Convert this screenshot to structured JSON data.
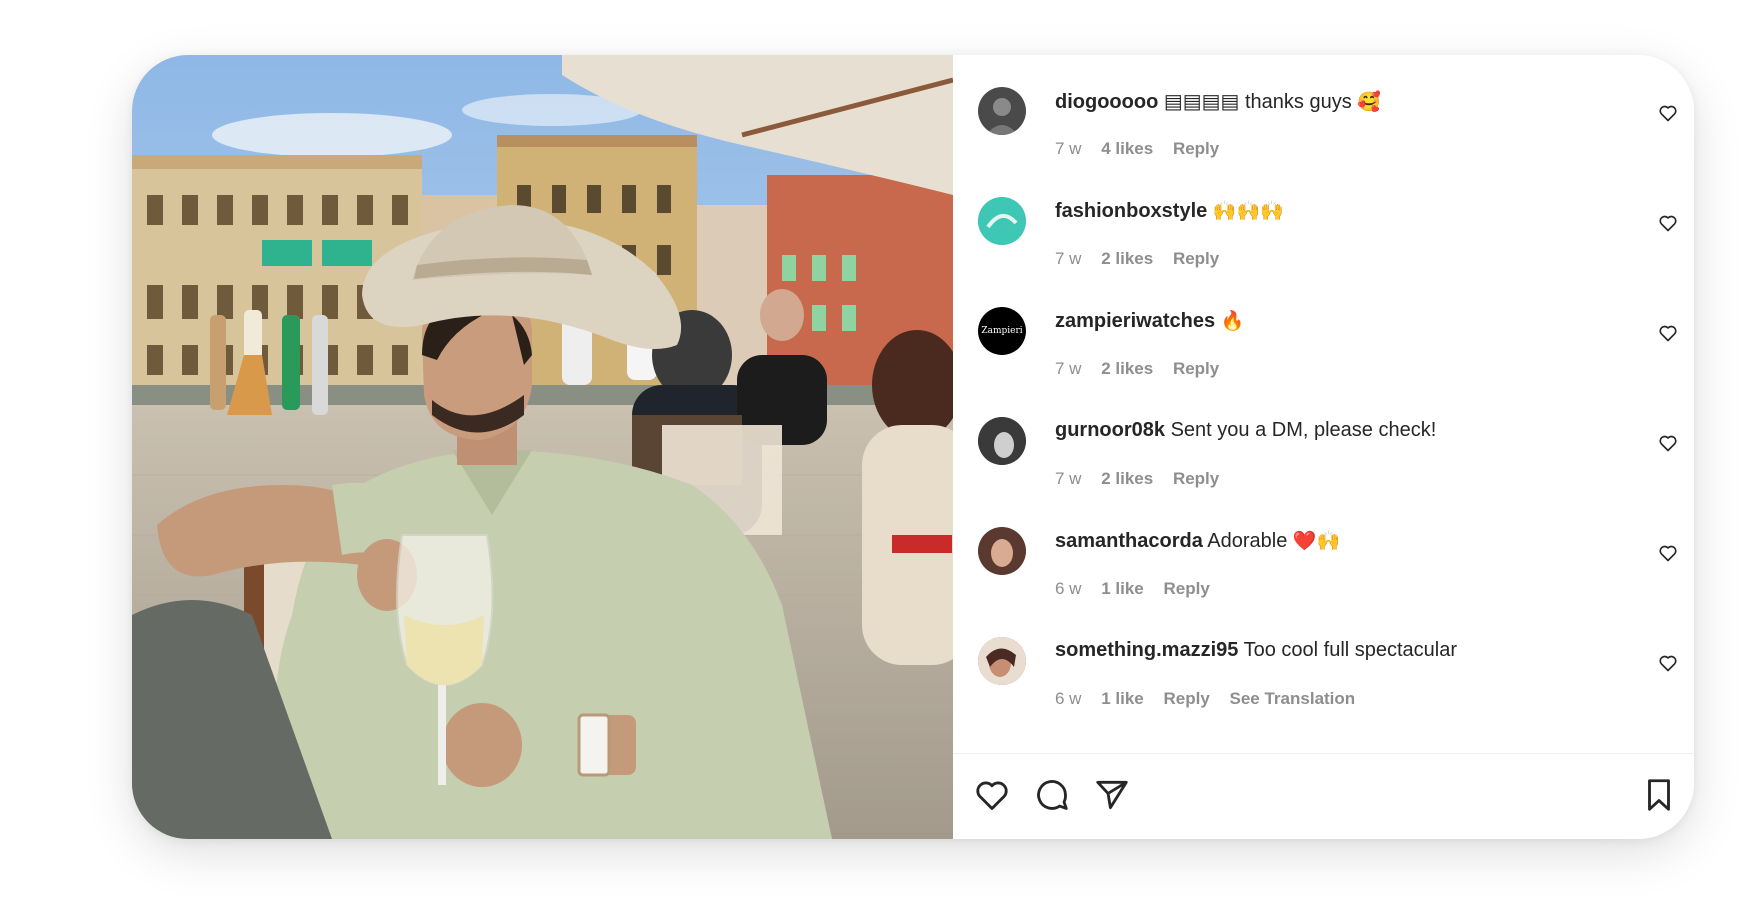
{
  "comments": [
    {
      "user": "diogooooo",
      "text": " ▤▤▤▤ thanks guys ",
      "emoji": "🥰",
      "time": "7 w",
      "likes": "4 likes",
      "reply": "Reply",
      "avatar_color": "#4a4a4a"
    },
    {
      "user": "fashionboxstyle",
      "text": " ",
      "emoji": "🙌🙌🙌",
      "time": "7 w",
      "likes": "2 likes",
      "reply": "Reply",
      "avatar_color": "#2fb7a4"
    },
    {
      "user": "zampieriwatches",
      "text": " ",
      "emoji": "🔥",
      "time": "7 w",
      "likes": "2 likes",
      "reply": "Reply",
      "avatar_color": "#000000",
      "avatar_text": "Zampieri"
    },
    {
      "user": "gurnoor08k",
      "text": " Sent you a DM, please check!",
      "emoji": "",
      "time": "7 w",
      "likes": "2 likes",
      "reply": "Reply",
      "avatar_color": "#3a3a3a"
    },
    {
      "user": "samanthacorda",
      "text": " Adorable ",
      "emoji": "❤️🙌",
      "time": "6 w",
      "likes": "1 like",
      "reply": "Reply",
      "avatar_color": "#8a5a4a"
    },
    {
      "user": "something.mazzi95",
      "text": " Too cool full spectacular",
      "emoji": "",
      "time": "6 w",
      "likes": "1 like",
      "reply": "Reply",
      "translation": "See Translation",
      "avatar_color": "#b07a66"
    }
  ],
  "icons": {
    "like": "heart-icon",
    "comment": "comment-icon",
    "share": "share-icon",
    "save": "bookmark-icon",
    "comment_like": "heart-icon"
  },
  "colors": {
    "text": "#262626",
    "secondary": "#8e8e8e",
    "divider": "#efefef"
  }
}
